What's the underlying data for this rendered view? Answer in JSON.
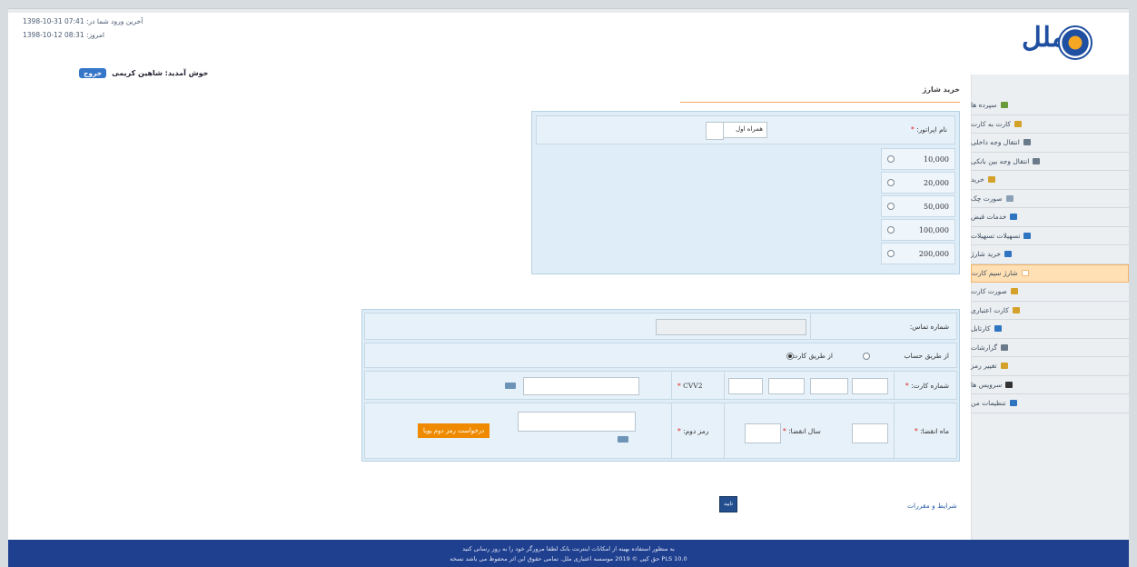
{
  "info": {
    "last_login": "1398-10-31 07:41 :آخرین ورود شما در",
    "today": "1398-10-12 08:31 :امروز"
  },
  "welcome": {
    "text": "خوش آمدید: شاهین کریمی",
    "logout": "خروج"
  },
  "brand": {
    "logo_text": "ملل"
  },
  "page_title": "خرید شارژ",
  "sidebar": {
    "items": [
      {
        "label": "سپرده ها",
        "icon": "deposit-icon",
        "color": "#6a9a3a"
      },
      {
        "label": "کارت به کارت",
        "icon": "card-transfer-icon",
        "color": "#d4a22a"
      },
      {
        "label": "انتقال وجه داخلی",
        "icon": "transfer-icon",
        "color": "#6a7a8a"
      },
      {
        "label": "انتقال وجه بین بانکی",
        "icon": "interbank-icon",
        "color": "#6a7a8a"
      },
      {
        "label": "خرید",
        "icon": "purchase-icon",
        "color": "#d4a22a"
      },
      {
        "label": "صورت چک",
        "icon": "cheque-icon",
        "color": "#8aa0b4"
      },
      {
        "label": "خدمات قبض",
        "icon": "bill-icon",
        "color": "#2f74c0"
      },
      {
        "label": "تسهیلات تسهیلات",
        "icon": "loan-icon",
        "color": "#2f74c0"
      },
      {
        "label": "خرید شارژ",
        "icon": "charge-icon",
        "color": "#2f74c0"
      },
      {
        "label": "شارژ سیم کارت",
        "icon": "sim-icon",
        "color": "#ffffff",
        "active": true
      },
      {
        "label": "صورت کارت",
        "icon": "card-icon",
        "color": "#d4a22a"
      },
      {
        "label": "کارت اعتباری",
        "icon": "credit-card-icon",
        "color": "#d4a22a"
      },
      {
        "label": "کارتابل",
        "icon": "cartable-icon",
        "color": "#2f74c0"
      },
      {
        "label": "گزارشات",
        "icon": "report-icon",
        "color": "#6a7a8a"
      },
      {
        "label": "تغییر رمز",
        "icon": "lock-icon",
        "color": "#d4a22a"
      },
      {
        "label": "سرویس ها",
        "icon": "service-icon",
        "color": "#333333"
      },
      {
        "label": "تنظیمات من",
        "icon": "settings-icon",
        "color": "#2f74c0"
      }
    ]
  },
  "operator": {
    "label": "نام اپراتور: ",
    "required": "*",
    "value": "همراه اول"
  },
  "amounts": [
    "10,000",
    "20,000",
    "50,000",
    "100,000",
    "200,000"
  ],
  "payment": {
    "mobile_label": "شماره تماس:",
    "method_account": "از طریق حساب",
    "method_card": "از طریق کارت",
    "card_label": "شماره کارت: ",
    "cvv2_label": "CVV2 ",
    "expiry_month_label": "ماه انقضا: ",
    "expiry_year_label": "سال انقضا: ",
    "password_label": "رمز دوم: ",
    "request_password": "درخواست رمز دوم پویا",
    "required": "*"
  },
  "terms": "شرایط و مقررات",
  "submit": "تایید",
  "footer": {
    "line1": "به منظور استفاده بهینه از امکانات اینترنت بانک لطفا مرورگر خود را به روز رسانی کنید",
    "line2": "حق کپی © 2019 موسسه اعتباری ملل. تمامی حقوق این اثر محفوظ می باشد نسخه PLS 10.0"
  },
  "colors": {
    "accent": "#1f3f8f",
    "orange": "#ef8a00",
    "panel": "#deedf7"
  }
}
